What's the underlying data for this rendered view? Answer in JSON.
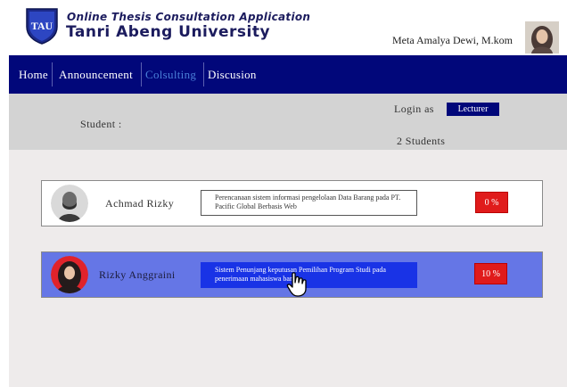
{
  "header": {
    "logo_text": "TAU",
    "app_subtitle": "Online Thesis Consultation Application",
    "app_title": "Tanri Abeng University",
    "user_name": "Meta Amalya Dewi, M.kom"
  },
  "nav": {
    "items": [
      {
        "label": "Home"
      },
      {
        "label": "Announcement"
      },
      {
        "label": "Colsulting"
      },
      {
        "label": "Discusion"
      }
    ]
  },
  "info": {
    "student_label": "Student :",
    "login_label": "Login as",
    "role": "Lecturer",
    "count": "2 Students"
  },
  "students": [
    {
      "name": "Achmad Rizky",
      "thesis": "Perencanaan sistem informasi pengelolaan Data Barang pada PT. Pacific Global Berbasis Web",
      "progress": "0 %"
    },
    {
      "name": "Rizky Anggraini",
      "thesis": "Sistem Penunjang keputusan Pemilihan Program Studi pada penerimaan mahasiswa baru",
      "progress": "10 %"
    }
  ],
  "colors": {
    "nav_bg": "#01077a",
    "active_nav": "#4a7fd8",
    "selected_row": "#6576e6",
    "selected_thesis": "#1933e6",
    "progress_badge": "#e01b1b"
  }
}
